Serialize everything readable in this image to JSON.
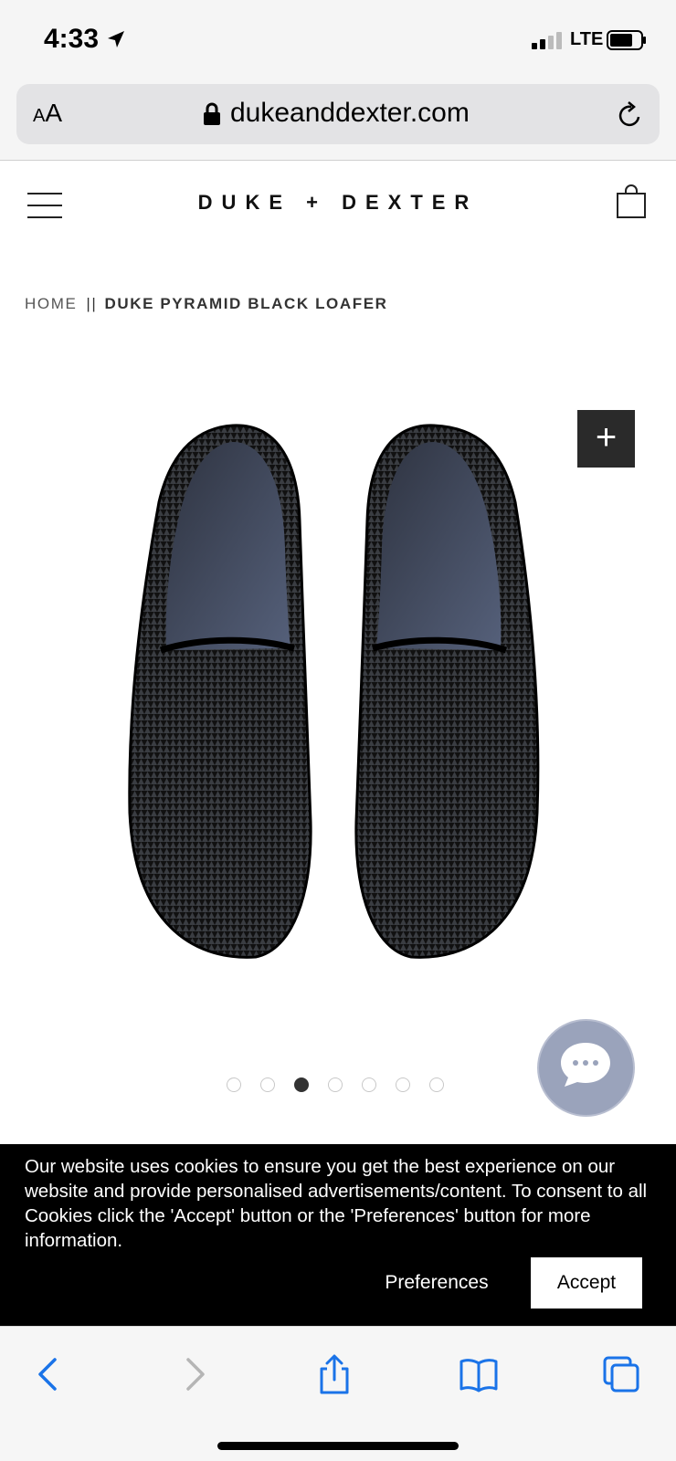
{
  "status": {
    "time": "4:33",
    "network": "LTE"
  },
  "browser": {
    "text_size_label_small": "A",
    "text_size_label_large": "A",
    "url": "dukeanddexter.com"
  },
  "site": {
    "brand": "DUKE + DEXTER"
  },
  "breadcrumb": {
    "home": "HOME",
    "separator": "||",
    "current": "DUKE PYRAMID BLACK LOAFER"
  },
  "product": {
    "zoom_label": "+",
    "gallery_count": 7,
    "gallery_active_index": 2
  },
  "cookie": {
    "message": "Our website uses cookies to ensure you get the best experience on our website and provide personalised advertisements/content. To consent to all Cookies click the 'Accept' button or the 'Preferences' button for more information.",
    "preferences_label": "Preferences",
    "accept_label": "Accept"
  },
  "icons": {
    "location": "location-arrow-icon",
    "lock": "lock-icon",
    "reload": "reload-icon",
    "menu": "hamburger-menu-icon",
    "bag": "shopping-bag-icon",
    "chat": "chat-bubble-icon",
    "back": "chevron-left-icon",
    "forward": "chevron-right-icon",
    "share": "share-icon",
    "bookmarks": "book-icon",
    "tabs": "tabs-icon"
  },
  "colors": {
    "safari_blue": "#1a73e8",
    "cookie_bg": "#000000",
    "zoom_bg": "#2a2a2a",
    "chat_bg": "#9aa3bb"
  }
}
